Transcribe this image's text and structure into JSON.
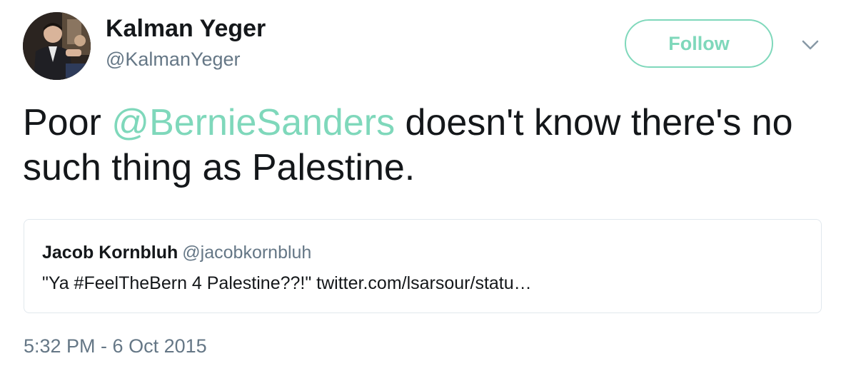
{
  "author": {
    "name": "Kalman Yeger",
    "handle": "@KalmanYeger"
  },
  "follow_button": {
    "label": "Follow"
  },
  "menu": {
    "icon": "chevron-down-icon"
  },
  "tweet": {
    "text_before": "Poor ",
    "mention": "@BernieSanders",
    "text_after": " doesn't know there's no such thing as Palestine."
  },
  "quoted_tweet": {
    "name": "Jacob Kornbluh",
    "handle": "@jacobkornbluh",
    "text": "\"Ya #FeelTheBern 4 Palestine??!\" twitter.com/lsarsour/statu…"
  },
  "timestamp": "5:32 PM - 6 Oct 2015",
  "colors": {
    "accent": "#7fd8bb",
    "text": "#14171a",
    "secondary_text": "#657786",
    "card_border": "#e1e8ed"
  }
}
